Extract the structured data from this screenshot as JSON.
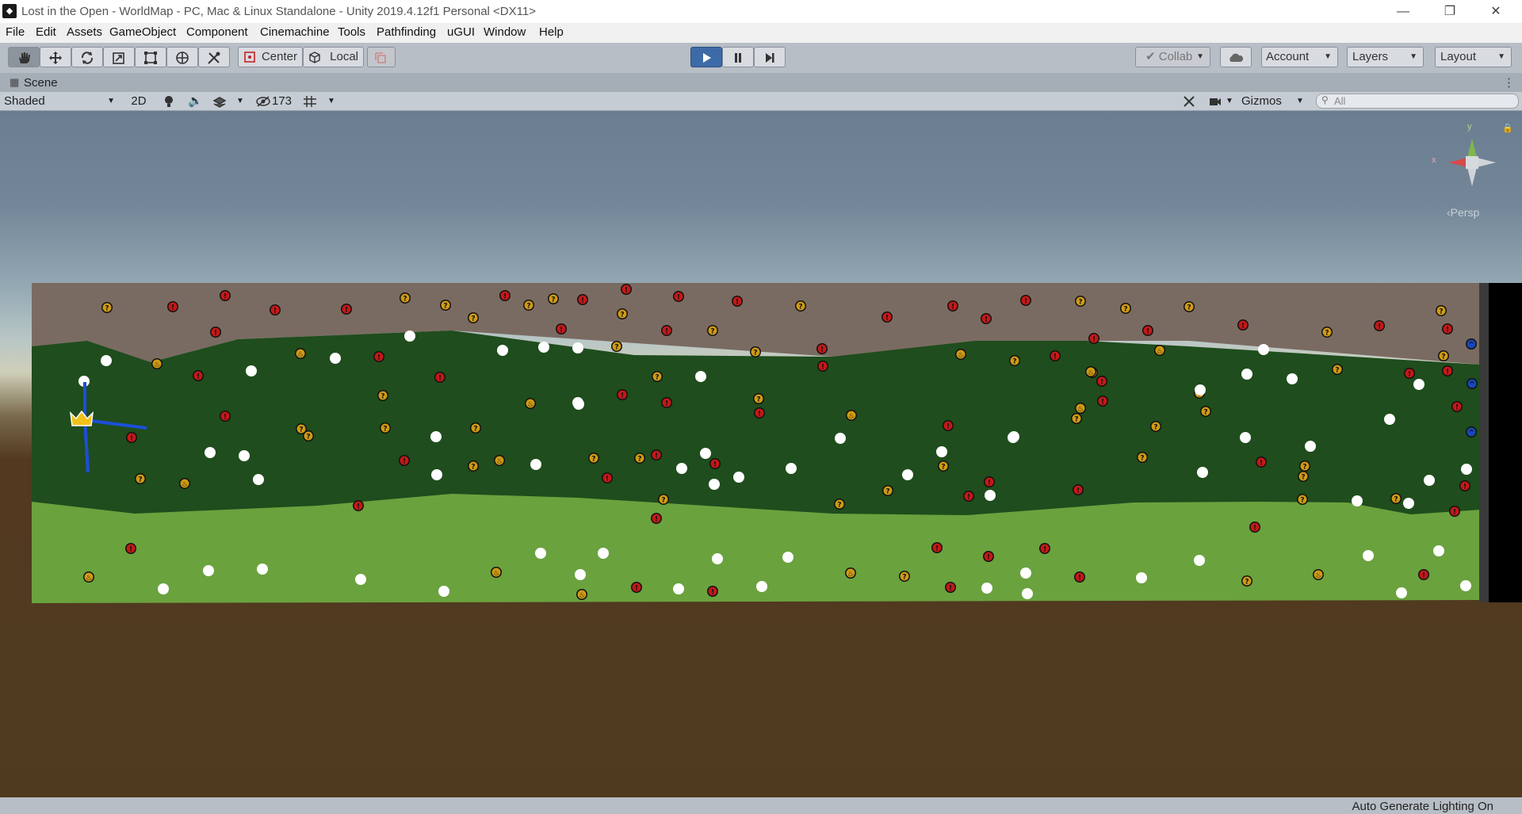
{
  "window": {
    "title": "Lost in the Open - WorldMap - PC, Mac & Linux Standalone - Unity 2019.4.12f1 Personal <DX11>",
    "app_icon": "unity-logo-icon",
    "controls": [
      "minimize-icon",
      "restore-icon",
      "close-icon"
    ]
  },
  "menu": [
    "File",
    "Edit",
    "Assets",
    "GameObject",
    "Component",
    "Cinemachine",
    "Tools",
    "Pathfinding",
    "uGUI",
    "Window",
    "Help"
  ],
  "toolbar": {
    "tools": [
      "hand-tool-icon",
      "move-tool-icon",
      "rotate-tool-icon",
      "scale-tool-icon",
      "rect-tool-icon",
      "transform-tool-icon",
      "custom-tool-icon"
    ],
    "pivot_label": "Center",
    "space_label": "Local",
    "collab_label": "Collab",
    "account_label": "Account",
    "layers_label": "Layers",
    "layout_label": "Layout",
    "play_state": "playing"
  },
  "scene_tab": {
    "label": "Scene"
  },
  "scene_toolbar": {
    "shading_mode": "Shaded",
    "mode_2d": "2D",
    "hidden_count": "173",
    "gizmos_label": "Gizmos",
    "search_placeholder": "All"
  },
  "scene_gizmo": {
    "x_label": "x",
    "y_label": "y",
    "projection_label": "Persp"
  },
  "status": {
    "text": "Auto Generate Lighting On"
  },
  "colors": {
    "band_top": "#7a6b62",
    "band_mid": "#1f4d1d",
    "band_bottom": "#6aa23e",
    "node_danger": "#c41818",
    "node_unknown": "#cf9a14",
    "node_visited": "#ffffff",
    "node_exit": "#1848b8",
    "route_line": "#1c4fd8",
    "crown": "#f2c21b"
  }
}
